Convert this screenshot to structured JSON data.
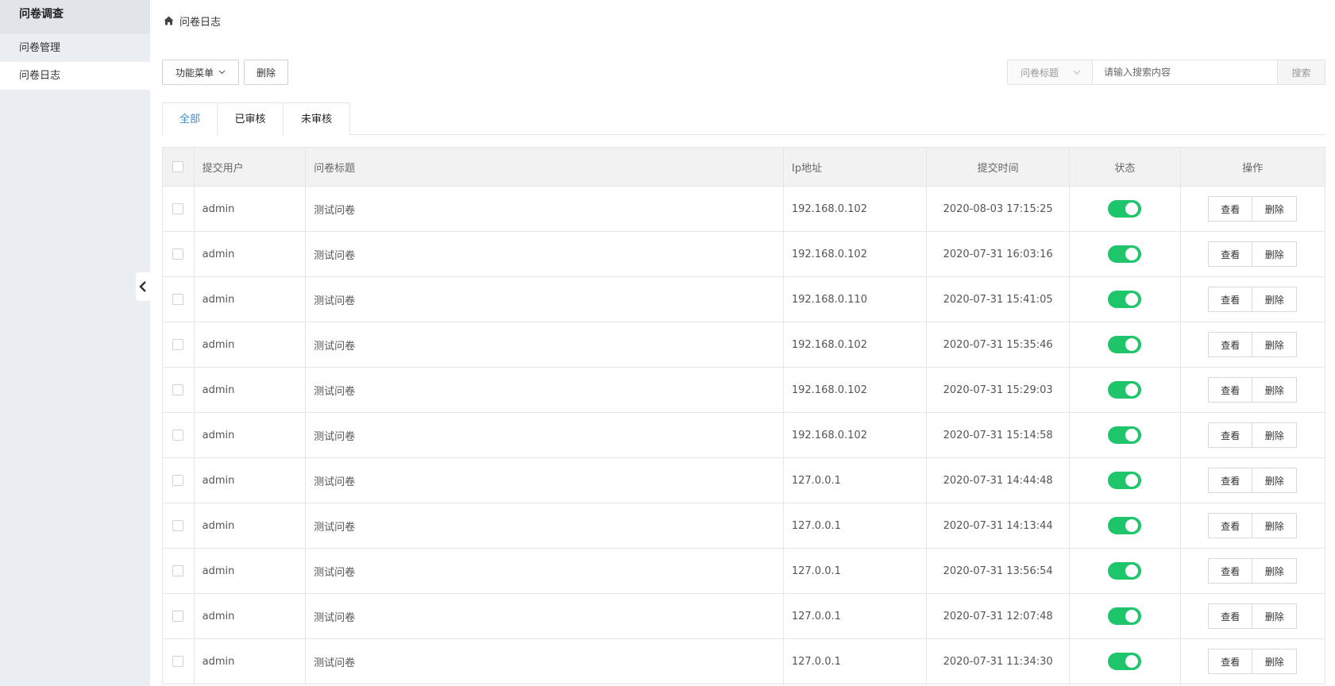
{
  "sidebar": {
    "title": "问卷调查",
    "items": [
      {
        "label": "问卷管理",
        "active": false
      },
      {
        "label": "问卷日志",
        "active": true
      }
    ]
  },
  "breadcrumb": {
    "icon": "home-icon",
    "label": "问卷日志"
  },
  "toolbar": {
    "func_menu_label": "功能菜单",
    "delete_label": "删除"
  },
  "search": {
    "field_label": "问卷标题",
    "placeholder": "请输入搜索内容",
    "value": "",
    "button_label": "搜索"
  },
  "tabs": [
    {
      "label": "全部",
      "active": true
    },
    {
      "label": "已审核",
      "active": false
    },
    {
      "label": "未审核",
      "active": false
    }
  ],
  "table": {
    "headers": {
      "user": "提交用户",
      "title": "问卷标题",
      "ip": "Ip地址",
      "time": "提交时间",
      "status": "状态",
      "actions": "操作"
    },
    "action_labels": {
      "view": "查看",
      "delete": "删除"
    },
    "rows": [
      {
        "user": "admin",
        "title": "测试问卷",
        "ip": "192.168.0.102",
        "time": "2020-08-03 17:15:25",
        "status": true
      },
      {
        "user": "admin",
        "title": "测试问卷",
        "ip": "192.168.0.102",
        "time": "2020-07-31 16:03:16",
        "status": true
      },
      {
        "user": "admin",
        "title": "测试问卷",
        "ip": "192.168.0.110",
        "time": "2020-07-31 15:41:05",
        "status": true
      },
      {
        "user": "admin",
        "title": "测试问卷",
        "ip": "192.168.0.102",
        "time": "2020-07-31 15:35:46",
        "status": true
      },
      {
        "user": "admin",
        "title": "测试问卷",
        "ip": "192.168.0.102",
        "time": "2020-07-31 15:29:03",
        "status": true
      },
      {
        "user": "admin",
        "title": "测试问卷",
        "ip": "192.168.0.102",
        "time": "2020-07-31 15:14:58",
        "status": true
      },
      {
        "user": "admin",
        "title": "测试问卷",
        "ip": "127.0.0.1",
        "time": "2020-07-31 14:44:48",
        "status": true
      },
      {
        "user": "admin",
        "title": "测试问卷",
        "ip": "127.0.0.1",
        "time": "2020-07-31 14:13:44",
        "status": true
      },
      {
        "user": "admin",
        "title": "测试问卷",
        "ip": "127.0.0.1",
        "time": "2020-07-31 13:56:54",
        "status": true
      },
      {
        "user": "admin",
        "title": "测试问卷",
        "ip": "127.0.0.1",
        "time": "2020-07-31 12:07:48",
        "status": true
      },
      {
        "user": "admin",
        "title": "测试问卷",
        "ip": "127.0.0.1",
        "time": "2020-07-31 11:34:30",
        "status": true
      }
    ]
  },
  "colors": {
    "accent": "#3e8ed0",
    "switch_on": "#1fc56a",
    "sidebar_bg": "#eaedf1"
  }
}
